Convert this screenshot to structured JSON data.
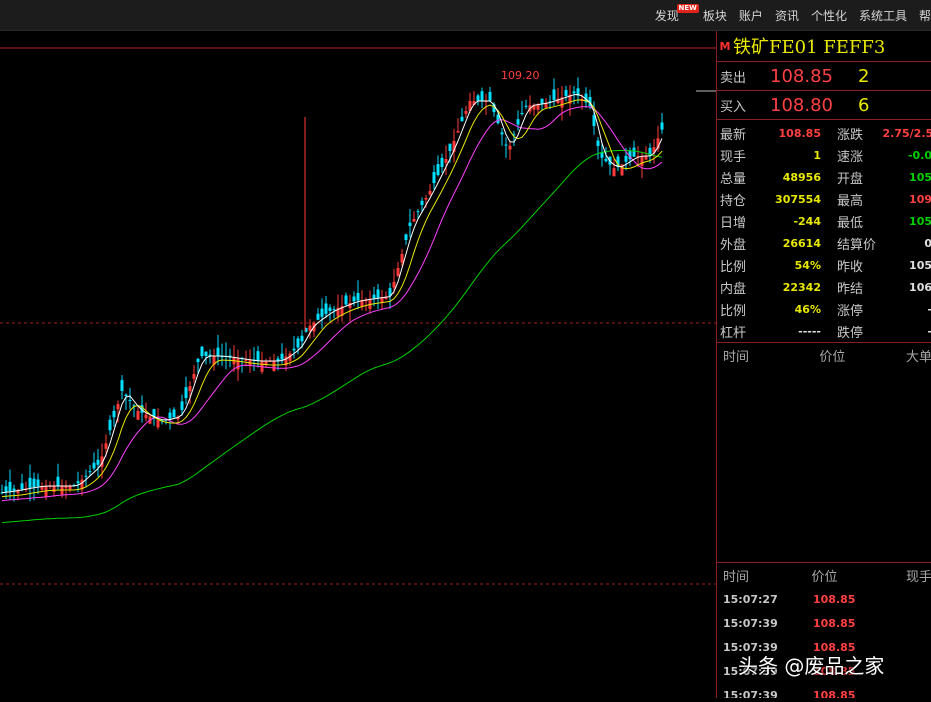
{
  "menu": {
    "items": [
      "发现",
      "板块",
      "账户",
      "资讯",
      "个性化",
      "系统工具",
      "帮"
    ],
    "new_badge": "NEW"
  },
  "chart": {
    "high_label": "109.20",
    "colors": {
      "up": "#ff3a3a",
      "down": "#00e0ff",
      "ma5": "#ffffff",
      "ma10": "#e8e800",
      "ma20": "#ff40ff",
      "ma60": "#00d000"
    }
  },
  "quote": {
    "badge": "M",
    "title": "铁矿FE01 FEFF3",
    "sell": {
      "label": "卖出",
      "price": "108.85",
      "volume": "2"
    },
    "buy": {
      "label": "买入",
      "price": "108.80",
      "volume": "6"
    }
  },
  "stats": [
    {
      "k1": "最新",
      "v1": "108.85",
      "c1": "red",
      "k2": "涨跌",
      "v2": "2.75/2.5",
      "c2": "red"
    },
    {
      "k1": "现手",
      "v1": "1",
      "c1": "yel",
      "k2": "速涨",
      "v2": "-0.0",
      "c2": "grn"
    },
    {
      "k1": "总量",
      "v1": "48956",
      "c1": "yel",
      "k2": "开盘",
      "v2": "105",
      "c2": "grn"
    },
    {
      "k1": "持仓",
      "v1": "307554",
      "c1": "yel",
      "k2": "最高",
      "v2": "109",
      "c2": "red"
    },
    {
      "k1": "日增",
      "v1": "-244",
      "c1": "yel",
      "k2": "最低",
      "v2": "105",
      "c2": "grn"
    },
    {
      "k1": "外盘",
      "v1": "26614",
      "c1": "yel",
      "k2": "结算价",
      "v2": "0",
      "c2": "wht"
    },
    {
      "k1": "比例",
      "v1": "54%",
      "c1": "yel",
      "k2": "昨收",
      "v2": "105",
      "c2": "wht"
    },
    {
      "k1": "内盘",
      "v1": "22342",
      "c1": "yel",
      "k2": "昨结",
      "v2": "106",
      "c2": "wht"
    },
    {
      "k1": "比例",
      "v1": "46%",
      "c1": "yel",
      "k2": "涨停",
      "v2": "-",
      "c2": "wht"
    },
    {
      "k1": "杠杆",
      "v1": "-----",
      "c1": "wht",
      "k2": "跌停",
      "v2": "-",
      "c2": "wht"
    }
  ],
  "minute_header": {
    "time": "时间",
    "price": "价位",
    "big": "大单"
  },
  "ticks_header": {
    "time": "时间",
    "price": "价位",
    "vol": "现手"
  },
  "ticks": [
    {
      "time": "15:07:27",
      "price": "108.85"
    },
    {
      "time": "15:07:39",
      "price": "108.85"
    },
    {
      "time": "15:07:39",
      "price": "108.85"
    },
    {
      "time": "15:07:39",
      "price": "108.85"
    },
    {
      "time": "15:07:39",
      "price": "108.85"
    }
  ],
  "watermark": "头条 @废品之家"
}
